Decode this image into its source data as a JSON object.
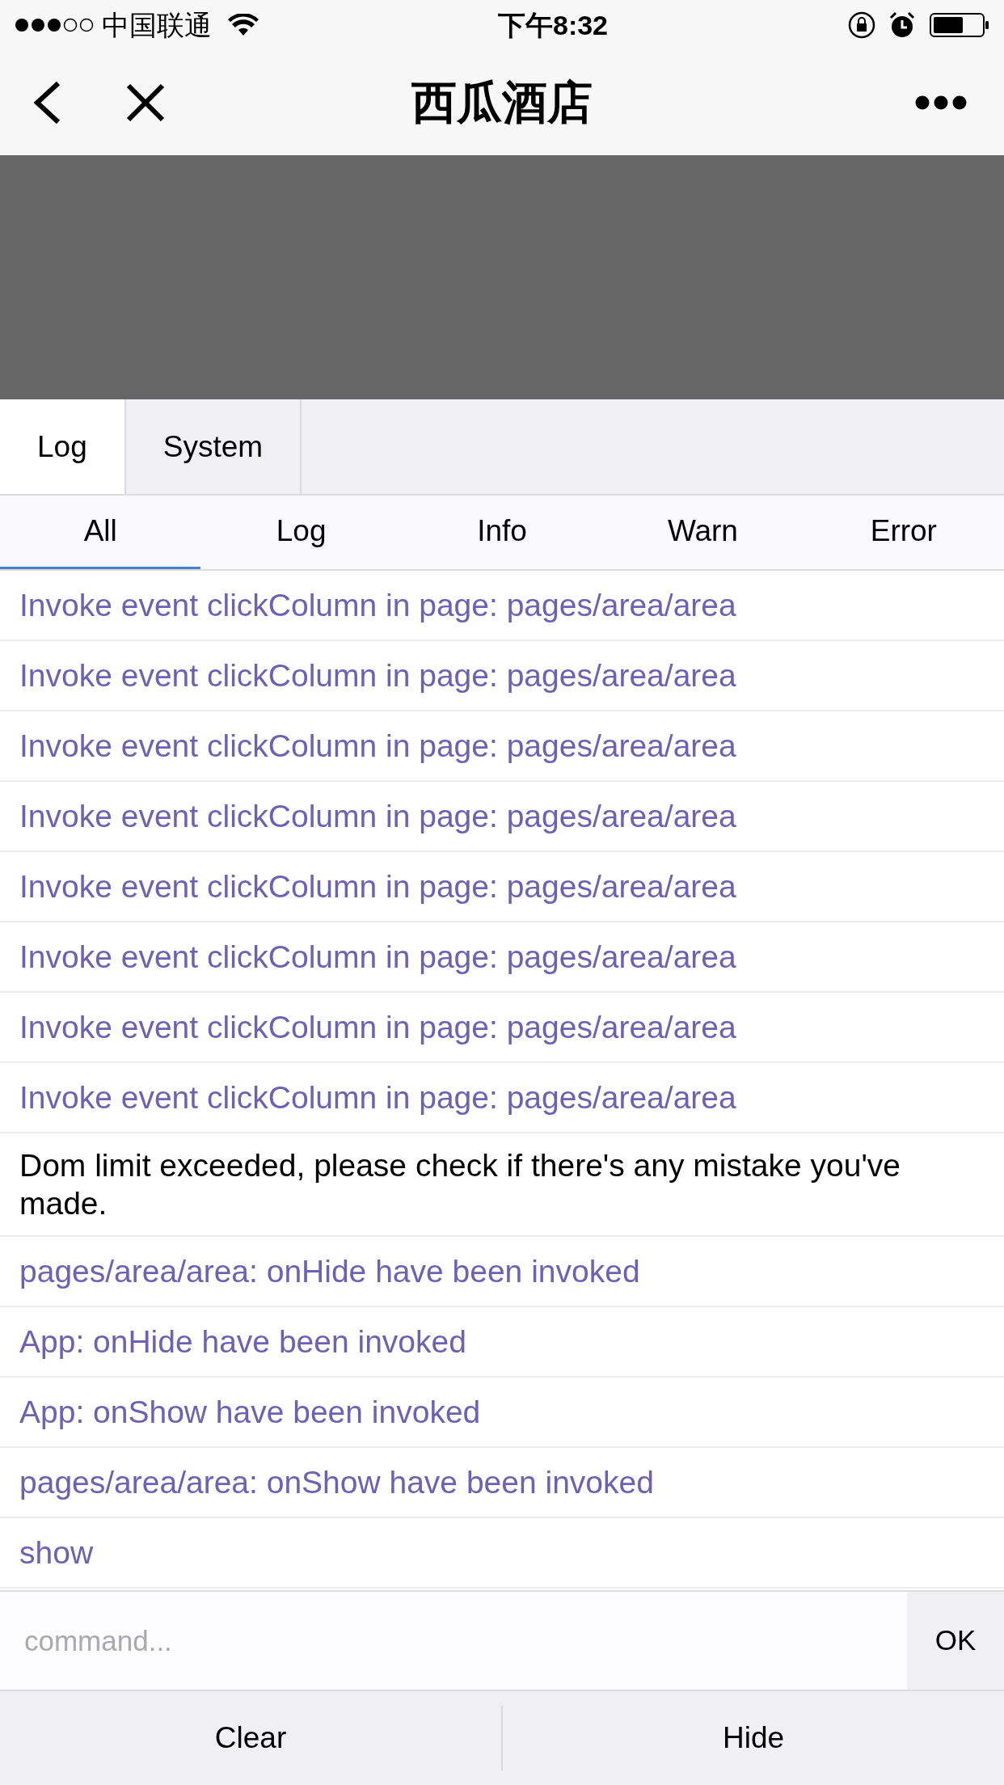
{
  "status_bar": {
    "carrier": "中国联通",
    "time": "下午8:32"
  },
  "nav": {
    "title": "西瓜酒店"
  },
  "tabs": [
    {
      "label": "Log",
      "selected": true
    },
    {
      "label": "System",
      "selected": false
    }
  ],
  "filters": [
    {
      "label": "All",
      "selected": true
    },
    {
      "label": "Log",
      "selected": false
    },
    {
      "label": "Info",
      "selected": false
    },
    {
      "label": "Warn",
      "selected": false
    },
    {
      "label": "Error",
      "selected": false
    }
  ],
  "entries": [
    {
      "kind": "info",
      "text": "Invoke event clickColumn in page: pages/area/area"
    },
    {
      "kind": "info",
      "text": "Invoke event clickColumn in page: pages/area/area"
    },
    {
      "kind": "info",
      "text": "Invoke event clickColumn in page: pages/area/area"
    },
    {
      "kind": "info",
      "text": "Invoke event clickColumn in page: pages/area/area"
    },
    {
      "kind": "info",
      "text": "Invoke event clickColumn in page: pages/area/area"
    },
    {
      "kind": "info",
      "text": "Invoke event clickColumn in page: pages/area/area"
    },
    {
      "kind": "info",
      "text": "Invoke event clickColumn in page: pages/area/area"
    },
    {
      "kind": "info",
      "text": "Invoke event clickColumn in page: pages/area/area"
    },
    {
      "kind": "log",
      "text": "Dom limit exceeded, please check if there's any mistake you've made."
    },
    {
      "kind": "info",
      "text": "pages/area/area: onHide have been invoked"
    },
    {
      "kind": "info",
      "text": "App: onHide have been invoked"
    },
    {
      "kind": "info",
      "text": "App: onShow have been invoked"
    },
    {
      "kind": "info",
      "text": "pages/area/area: onShow have been invoked"
    },
    {
      "kind": "info",
      "text": "show"
    }
  ],
  "command": {
    "placeholder": "command...",
    "submit": "OK"
  },
  "actions": [
    "Clear",
    "Hide"
  ]
}
